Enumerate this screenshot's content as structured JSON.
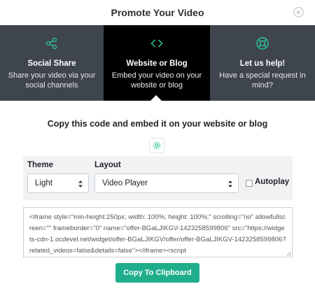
{
  "modal": {
    "title": "Promote Your Video"
  },
  "tabs": [
    {
      "title": "Social Share",
      "subtitle": "Share your video via your social channels",
      "icon": "share-icon",
      "active": false
    },
    {
      "title": "Website or Blog",
      "subtitle": "Embed your video on your website or blog",
      "icon": "code-icon",
      "active": true
    },
    {
      "title": "Let us help!",
      "subtitle": "Have a special request in mind?",
      "icon": "lifebuoy-icon",
      "active": false
    }
  ],
  "embed": {
    "heading": "Copy this code and embed it on your website or blog",
    "theme_label": "Theme",
    "theme_value": "Light",
    "layout_label": "Layout",
    "layout_value": "Video Player",
    "autoplay_label": "Autoplay",
    "autoplay_checked": false,
    "code": "<iframe style=\"min-height:250px; width: 100%; height: 100%;\" scrolling=\"no\" allowfullscreen=\"\" frameborder=\"0\" name=\"offer-BGaLJIKGV-1423258599806\" src=\"https://widgets-cdn-1.ocdevel.net/widget/offer-BGaLJIKGV/offer/offer-BGaLJIKGV-1423258599806?related_videos=false&details=false\"></iframe><script",
    "copy_button": "Copy To Clipboard"
  },
  "colors": {
    "accent": "#1fae8b",
    "tab_bg": "#3e454c",
    "tab_active": "#000000",
    "tab_icon": "#2cc69a"
  }
}
